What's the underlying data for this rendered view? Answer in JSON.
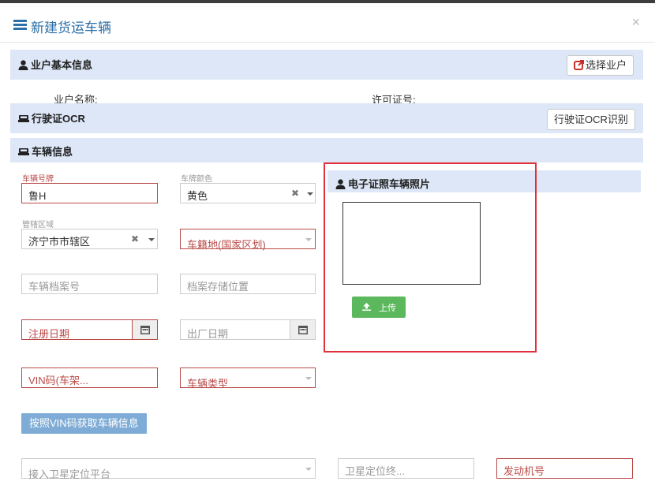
{
  "modal": {
    "title": "新建货运车辆",
    "close": "×"
  },
  "owner_section": {
    "title": "业户基本信息",
    "select_button": "选择业户",
    "name_label": "业户名称:",
    "license_label": "许可证号:"
  },
  "ocr_section": {
    "title": "行驶证OCR",
    "button": "行驶证OCR识别"
  },
  "vehicle_section": {
    "title": "车辆信息"
  },
  "form": {
    "plate_label": "车辆号牌",
    "plate_value": "鲁H",
    "plate_color_label": "车牌颜色",
    "plate_color_value": "黄色",
    "district_label": "管辖区域",
    "district_value": "济宁市市辖区",
    "origin_placeholder": "车籍地(国家区划)",
    "archive_no_placeholder": "车辆档案号",
    "archive_loc_placeholder": "档案存储位置",
    "reg_date_placeholder": "注册日期",
    "factory_date_placeholder": "出厂日期",
    "vin_placeholder": "VIN码(车架...",
    "vehicle_type_placeholder": "车辆类型",
    "vin_fetch_button": "按照VIN码获取车辆信息",
    "gps_platform_placeholder": "接入卫星定位平台",
    "gps_terminal_placeholder": "卫星定位终...",
    "engine_placeholder": "发动机号"
  },
  "photo_section": {
    "title": "电子证照车辆照片",
    "upload_button": "上传"
  },
  "colors": {
    "header_blue": "#2b6fa8",
    "section_bg": "#dde7f7",
    "required_red": "#b94a48",
    "highlight_red": "#e0303b",
    "upload_green": "#5cb85c",
    "vin_button_blue": "#7eacd6"
  },
  "icons": [
    "list-icon",
    "user-icon",
    "external-link-icon",
    "car-icon",
    "calendar-icon",
    "upload-icon",
    "chevron-down-icon",
    "clear-icon"
  ]
}
